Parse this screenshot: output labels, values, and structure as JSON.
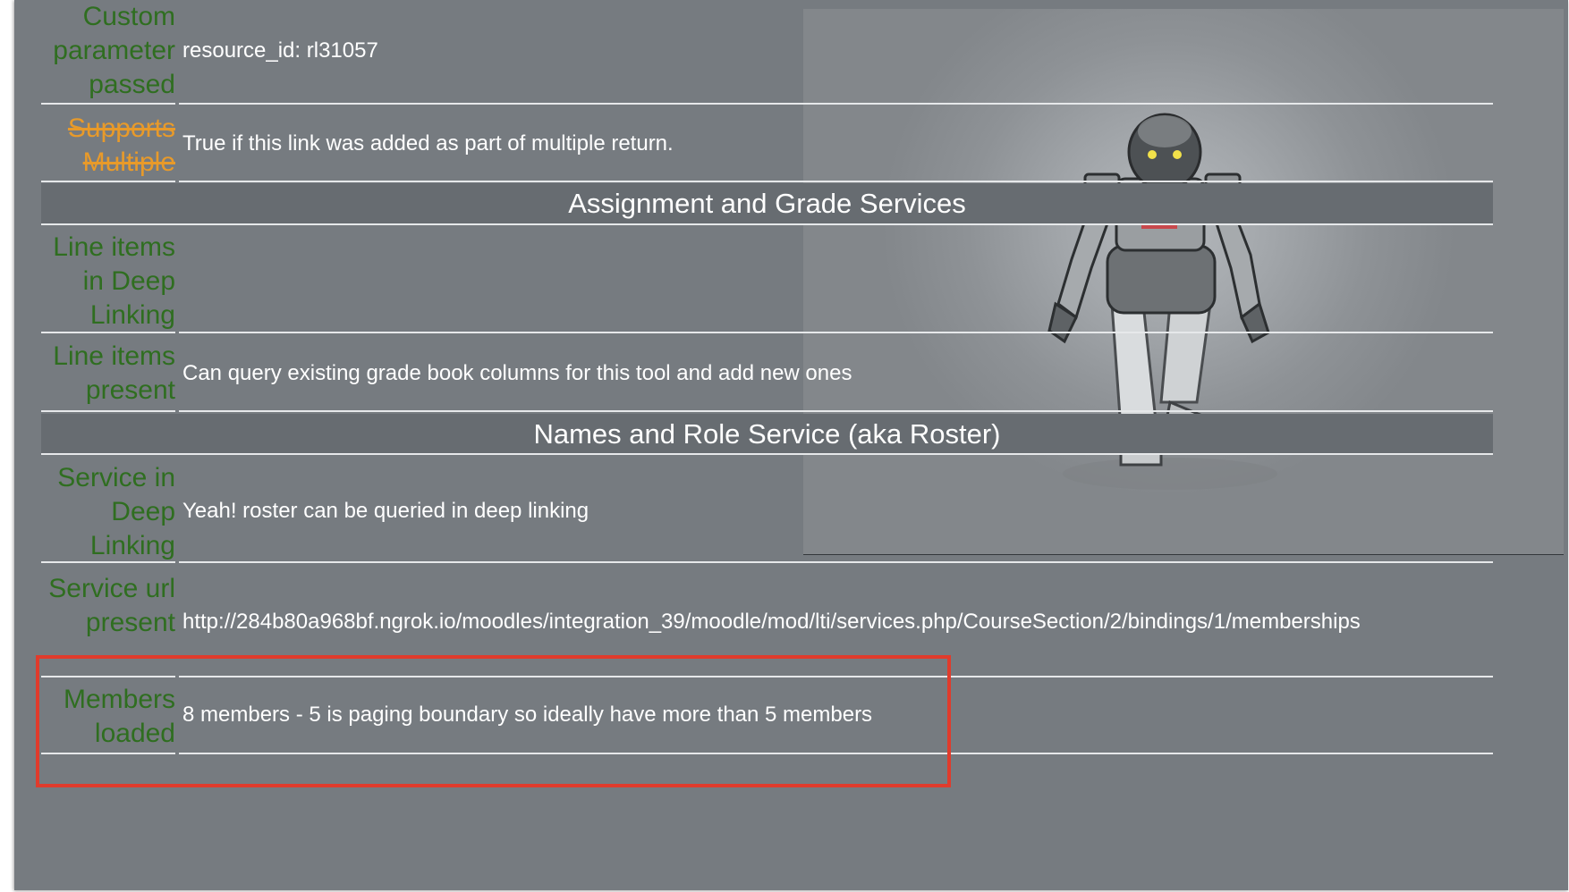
{
  "rows": [
    {
      "label": "Custom parameter passed",
      "value": "resource_id: rl31057"
    },
    {
      "label": "Supports Multiple",
      "value": "True if this link was added as part of multiple return."
    },
    {
      "label": "Line items in Deep Linking",
      "value": ""
    },
    {
      "label": "Line items present",
      "value": "Can query existing grade book columns for this tool and add new ones"
    },
    {
      "label": "Service in Deep Linking",
      "value": "Yeah! roster can be queried in deep linking"
    },
    {
      "label": "Service url present",
      "value": "http://284b80a968bf.ngrok.io/moodles/integration_39/moodle/mod/lti/services.php/CourseSection/2/bindings/1/memberships"
    },
    {
      "label": "Members loaded",
      "value": "8 members - 5 is paging boundary so ideally have more than 5 members"
    }
  ],
  "sections": {
    "ags": "Assignment and Grade Services",
    "nrps": "Names and Role Service (aka Roster)"
  },
  "colors": {
    "panel_bg": "#767b80",
    "label_green": "#2f6e20",
    "label_struck_orange": "#e89a2a",
    "highlight_red": "#e03b2c"
  },
  "icons": {
    "background": "robot-image"
  }
}
